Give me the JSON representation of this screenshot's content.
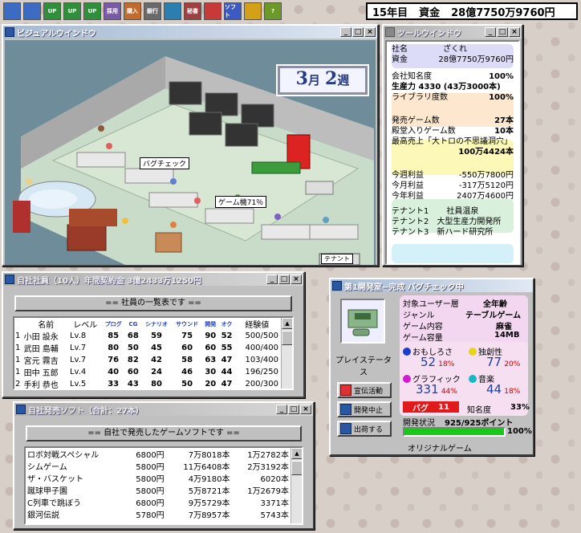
{
  "toolbar": {
    "icons": [
      {
        "name": "home-icon",
        "label": "",
        "color": "#3c6bc4"
      },
      {
        "name": "house-icon",
        "label": "",
        "color": "#3c6bc4"
      },
      {
        "name": "upgrade-icon-1",
        "label": "UP",
        "color": "#2f8f3b"
      },
      {
        "name": "upgrade-icon-2",
        "label": "UP",
        "color": "#2f8f3b"
      },
      {
        "name": "upgrade-icon-3",
        "label": "UP",
        "color": "#2f8f3b"
      },
      {
        "name": "hire-icon",
        "label": "採用",
        "color": "#7a5aa8"
      },
      {
        "name": "buy-tech-icon",
        "label": "購入",
        "color": "#c36b2b"
      },
      {
        "name": "bank-icon",
        "label": "銀行",
        "color": "#6a6a6a"
      },
      {
        "name": "license-icon",
        "label": "",
        "color": "#2a7fb0"
      },
      {
        "name": "secretary-icon",
        "label": "秘書",
        "color": "#a04040"
      },
      {
        "name": "contest-icon",
        "label": "",
        "color": "#c83a3a"
      },
      {
        "name": "soft-icon",
        "label": "ソフト",
        "color": "#3c5ac4"
      },
      {
        "name": "ranking-icon",
        "label": "",
        "color": "#d4a017"
      },
      {
        "name": "help-icon",
        "label": "?",
        "color": "#6c9a2a"
      }
    ]
  },
  "status": {
    "year": "15年目",
    "funds_label": "資金",
    "funds": "28億7750万9760円"
  },
  "visual_window": {
    "title": "ビジュアルウインドウ",
    "month": "3",
    "month_unit": "月",
    "week": "2",
    "week_unit": "週",
    "bubble_bug": "バグチェック",
    "bubble_game": "ゲーム機71％",
    "sign": "テナント"
  },
  "tool_window": {
    "title": "ツールウインドウ",
    "company_label": "社名",
    "company": "ざくれ",
    "funds_label": "資金",
    "funds": "28億7750万9760円",
    "fame_label": "会社知名度",
    "fame": "100%",
    "power_label": "生産力 4330 (43万3000本)",
    "library_label": "ライブラリ度数",
    "library": "100%",
    "released_label": "発売ゲーム数",
    "released": "27本",
    "hall_label": "殿堂入りゲーム数",
    "hall": "10本",
    "best_label": "最高売上「大トロの不思議洞穴」",
    "best": "100万4424本",
    "week_profit_label": "今週利益",
    "week_profit": "-550万7800円",
    "month_profit_label": "今月利益",
    "month_profit": "-317万5120円",
    "year_profit_label": "今年利益",
    "year_profit": "2407万4600円",
    "tenant1_label": "テナント1",
    "tenant1": "社員温泉",
    "tenant2_label": "テナント2",
    "tenant2": "大型生産力開発所",
    "tenant3_label": "テナント3",
    "tenant3": "新ハード研究所"
  },
  "staff_window": {
    "title": "自社社員（10人）年間契約金 3億2433万1250円",
    "caption": "== 社員の一覧表です ==",
    "headers": [
      "",
      "名前",
      "レベル",
      "プログ",
      "CG",
      "シナリオ",
      "サウンド",
      "開発",
      "オク",
      "経験値"
    ],
    "rows": [
      [
        "1",
        "小田 設永",
        "Lv.8",
        "85",
        "68",
        "59",
        "75",
        "90",
        "52",
        "500/500"
      ],
      [
        "1",
        "武田 島輔",
        "Lv.7",
        "80",
        "50",
        "45",
        "60",
        "60",
        "55",
        "400/400"
      ],
      [
        "1",
        "宮元 霧吉",
        "Lv.7",
        "76",
        "82",
        "42",
        "58",
        "63",
        "47",
        "103/400"
      ],
      [
        "1",
        "田中 五郎",
        "Lv.4",
        "40",
        "60",
        "24",
        "46",
        "30",
        "44",
        "196/250"
      ],
      [
        "2",
        "手利 恭也",
        "Lv.5",
        "33",
        "43",
        "80",
        "50",
        "20",
        "47",
        "200/300"
      ]
    ]
  },
  "soft_window": {
    "title": "自社発売ソフト（合計：27本）",
    "caption": "== 自社で発売したゲームソフトです ==",
    "rows": [
      [
        "ロボ対戦スペシャル",
        "6800円",
        "7万8018本",
        "1万2782本"
      ],
      [
        "シムゲーム",
        "5800円",
        "11万6408本",
        "2万3192本"
      ],
      [
        "ザ・バスケット",
        "5800円",
        "4万9180本",
        "6020本"
      ],
      [
        "蹴球甲子園",
        "5800円",
        "5万8721本",
        "1万2679本"
      ],
      [
        "C列車で跳ぼう",
        "6800円",
        "9万5729本",
        "3371本"
      ],
      [
        "銀河伝説",
        "5780円",
        "7万8957本",
        "5743本"
      ]
    ]
  },
  "dev_window": {
    "title": "第1開発室−完成 バグチェック中",
    "platform_label": "プレイステータス",
    "target_label": "対象ユーザー層",
    "target": "全年齢",
    "genre_label": "ジャンル",
    "genre": "テーブルゲーム",
    "content_label": "ゲーム内容",
    "content": "麻雀",
    "size_label": "ゲーム容量",
    "size": "14MB",
    "fun_label": "おもしろさ",
    "fun": "52",
    "fun_pct": "18%",
    "orig_label": "独創性",
    "orig": "77",
    "orig_pct": "20%",
    "graphic_label": "グラフィック",
    "graphic": "331",
    "graphic_pct": "44%",
    "sound_label": "音楽",
    "sound": "44",
    "sound_pct": "18%",
    "bug_label": "バグ",
    "bug": "11",
    "fame_label": "知名度",
    "fame": "33%",
    "progress_label": "開発状況",
    "progress_value": "925/925ポイント",
    "progress_pct": "100%",
    "progress_fraction": 1.0,
    "original": "オリジナルゲーム",
    "btn_ad": "宣伝活動",
    "btn_stop": "開発中止",
    "btn_ship": "出荷する"
  }
}
